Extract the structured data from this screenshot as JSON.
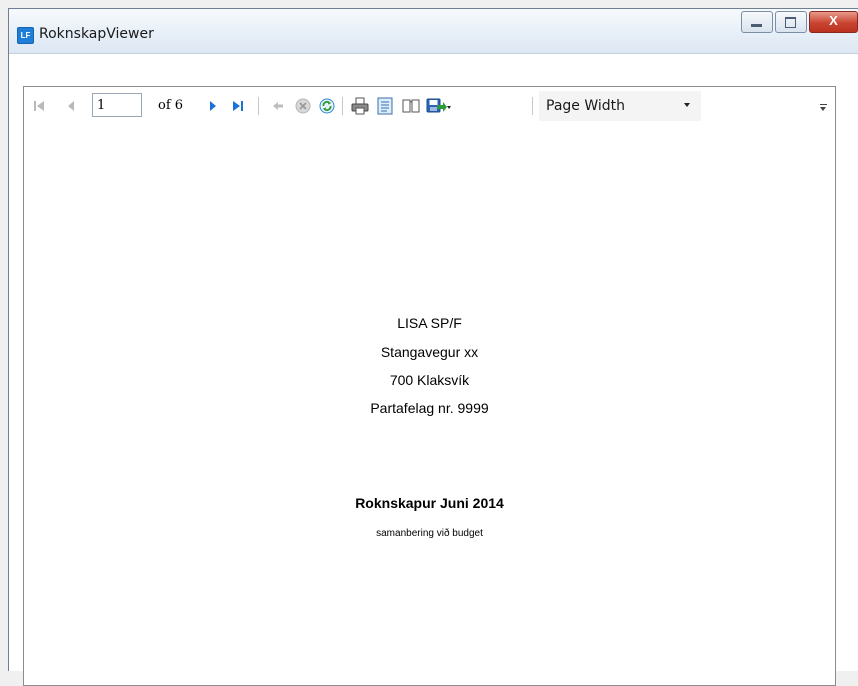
{
  "window": {
    "app_icon": "LF",
    "title": "RoknskapViewer",
    "buttons": {
      "minimize": "minimize",
      "maximize": "maximize",
      "close": "X"
    }
  },
  "toolbar": {
    "page_number": "1",
    "page_of": "of 6",
    "zoom": "Page Width",
    "icons": [
      "first-page-icon",
      "previous-page-icon",
      "next-page-icon",
      "last-page-icon",
      "back-icon",
      "stop-icon",
      "refresh-icon",
      "print-icon",
      "print-layout-icon",
      "page-setup-icon",
      "export-icon"
    ]
  },
  "report": {
    "address": [
      "LISA SP/F",
      "Stangavegur xx",
      "700 Klaksvík",
      "Partafelag nr. 9999"
    ],
    "title": "Roknskapur Juni 2014",
    "subtitle": "samanbering við budget"
  },
  "colors": {
    "close_button": "#c94430",
    "nav_blue": "#1a73d9",
    "refresh_green": "#2e9b3a"
  }
}
